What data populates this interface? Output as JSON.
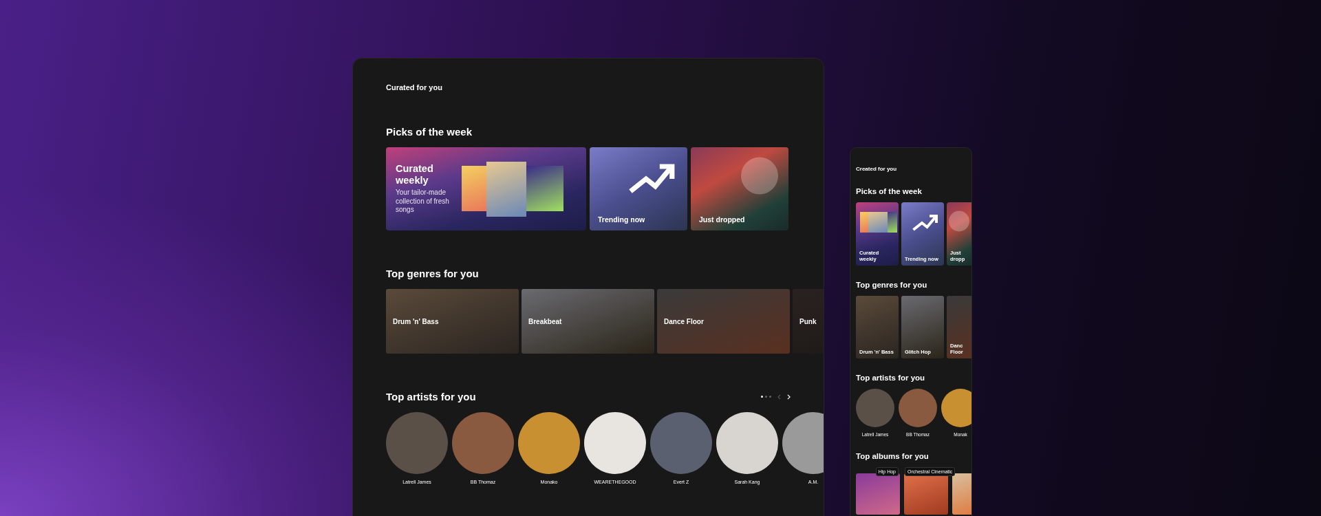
{
  "desktop": {
    "section_label": "Curated for you",
    "picks": {
      "title": "Picks of the week",
      "cards": [
        {
          "kind": "curated",
          "title": "Curated weekly",
          "subtitle": "Your tailor-made collection of fresh songs"
        },
        {
          "kind": "trending",
          "title": "Trending now"
        },
        {
          "kind": "new",
          "title": "Just dropped"
        }
      ]
    },
    "genres": {
      "title": "Top genres for you",
      "items": [
        {
          "label": "Drum 'n' Bass"
        },
        {
          "label": "Breakbeat"
        },
        {
          "label": "Dance Floor"
        },
        {
          "label": "Punk"
        }
      ]
    },
    "artists": {
      "title": "Top artists for you",
      "pager": [
        {
          "selected": true
        },
        {
          "selected": false
        },
        {
          "selected": false
        }
      ],
      "items": [
        {
          "name": "Latrell James"
        },
        {
          "name": "BB Thomaz"
        },
        {
          "name": "Monako"
        },
        {
          "name": "WEARETHEGOOD"
        },
        {
          "name": "Evert Z"
        },
        {
          "name": "Sarah Kang"
        },
        {
          "name": "A.M."
        }
      ]
    }
  },
  "mobile": {
    "section_label": "Created for you",
    "picks": {
      "title": "Picks of the week",
      "cards": [
        {
          "kind": "curated",
          "title": "Curated weekly"
        },
        {
          "kind": "trending",
          "title": "Trending now"
        },
        {
          "kind": "new",
          "title": "Just dropp"
        }
      ]
    },
    "genres": {
      "title": "Top genres for you",
      "items": [
        {
          "label": "Drum 'n' Bass"
        },
        {
          "label": "Glitch Hop"
        },
        {
          "label": "Danc Floor"
        }
      ]
    },
    "artists": {
      "title": "Top artists for you",
      "items": [
        {
          "name": "Latrell James"
        },
        {
          "name": "BB Thomaz"
        },
        {
          "name": "Monak"
        }
      ]
    },
    "albums": {
      "title": "Top albums for you",
      "items": [
        {
          "tag": "Hip Hop"
        },
        {
          "tag": "Orchestral Cinematic"
        }
      ]
    }
  }
}
